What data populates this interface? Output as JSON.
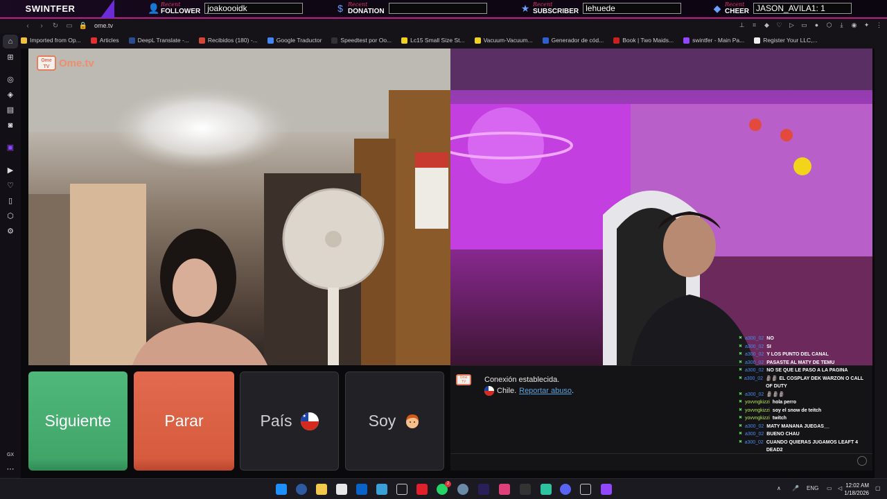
{
  "overlay": {
    "brand": "SWINTFER",
    "recent_word": "Recent",
    "groups": [
      {
        "type": "FOLLOWER",
        "value": "joakoooidk",
        "icon": "person-icon"
      },
      {
        "type": "DONATION",
        "value": "",
        "icon": "dollar-icon"
      },
      {
        "type": "SUBSCRIBER",
        "value": "lehuede",
        "icon": "star-icon"
      },
      {
        "type": "CHEER",
        "value": "JASON_AVILA1: 1",
        "icon": "bits-icon"
      }
    ],
    "colors": {
      "accent": "#c01c8c",
      "purple": "#6b2bd6",
      "recent": "#e0306a"
    }
  },
  "browser": {
    "url": "ome.tv",
    "bookmarks": [
      {
        "label": "Imported from Op...",
        "color": "#f0c040"
      },
      {
        "label": "Articles",
        "color": "#e03030"
      },
      {
        "label": "DeepL Translate -...",
        "color": "#2a4d8f"
      },
      {
        "label": "Recibidos (180) -...",
        "color": "#d44638"
      },
      {
        "label": "Google Traductor",
        "color": "#4285f4"
      },
      {
        "label": "Speedtest por Oo...",
        "color": "#333333"
      },
      {
        "label": "Lc15 Small Size St...",
        "color": "#f0d020"
      },
      {
        "label": "Vacuum-Vacuum...",
        "color": "#f0d020"
      },
      {
        "label": "Generador de cód...",
        "color": "#3060d0"
      },
      {
        "label": "Book | Two Maids...",
        "color": "#cc2020"
      },
      {
        "label": "swintfer - Main Pa...",
        "color": "#9146ff"
      },
      {
        "label": "Register Your LLC,...",
        "color": "#eeeeee"
      }
    ],
    "sidebar_bottom": "GX"
  },
  "ome": {
    "logo_text": "Ome.tv",
    "logo_badge": "Ome TV",
    "buttons": {
      "next": "Siguiente",
      "stop": "Parar",
      "country": "País",
      "gender": "Soy"
    },
    "chat": {
      "connection": "Conexión establecida.",
      "country": "Chile.",
      "report": "Reportar abuso",
      "report_suffix": "."
    }
  },
  "twitch_chat": [
    {
      "user": "a300_02",
      "text": "NO",
      "user_color": "blue"
    },
    {
      "user": "a300_02",
      "text": "SI",
      "user_color": "blue"
    },
    {
      "user": "a300_02",
      "text": "Y LOS PUNTO DEL CANAL",
      "user_color": "blue"
    },
    {
      "user": "a300_02",
      "text": "PASASTE AL MATY DE TEMU",
      "user_color": "blue"
    },
    {
      "user": "a300_02",
      "text": "NO SE QUE LE PASO A LA PAGINA",
      "user_color": "blue"
    },
    {
      "user": "a300_02",
      "text": "🗿🗿 EL COSPLAY DEK WARZON O CALL OF DUTY",
      "user_color": "blue"
    },
    {
      "user": "a300_02",
      "text": "🗿🗿🗿",
      "user_color": "blue"
    },
    {
      "user": "yovvngkizzi",
      "text": "hola perro",
      "user_color": "green"
    },
    {
      "user": "yovvngkizzi",
      "text": "soy el snow de teitch",
      "user_color": "green"
    },
    {
      "user": "yovvngkizzi",
      "text": "twitch",
      "user_color": "green"
    },
    {
      "user": "a300_02",
      "text": "MATY MANANA JUEGAS__",
      "user_color": "blue"
    },
    {
      "user": "a300_02",
      "text": "BUENO CHAU",
      "user_color": "blue"
    },
    {
      "user": "a300_02",
      "text": "CUANDO QUIERAS JUGAMOS LEAFT 4 DEAD2",
      "user_color": "blue"
    }
  ],
  "taskbar": {
    "language": "ENG",
    "time": "12:02 AM",
    "date": "1/18/2026",
    "badge": "2"
  }
}
